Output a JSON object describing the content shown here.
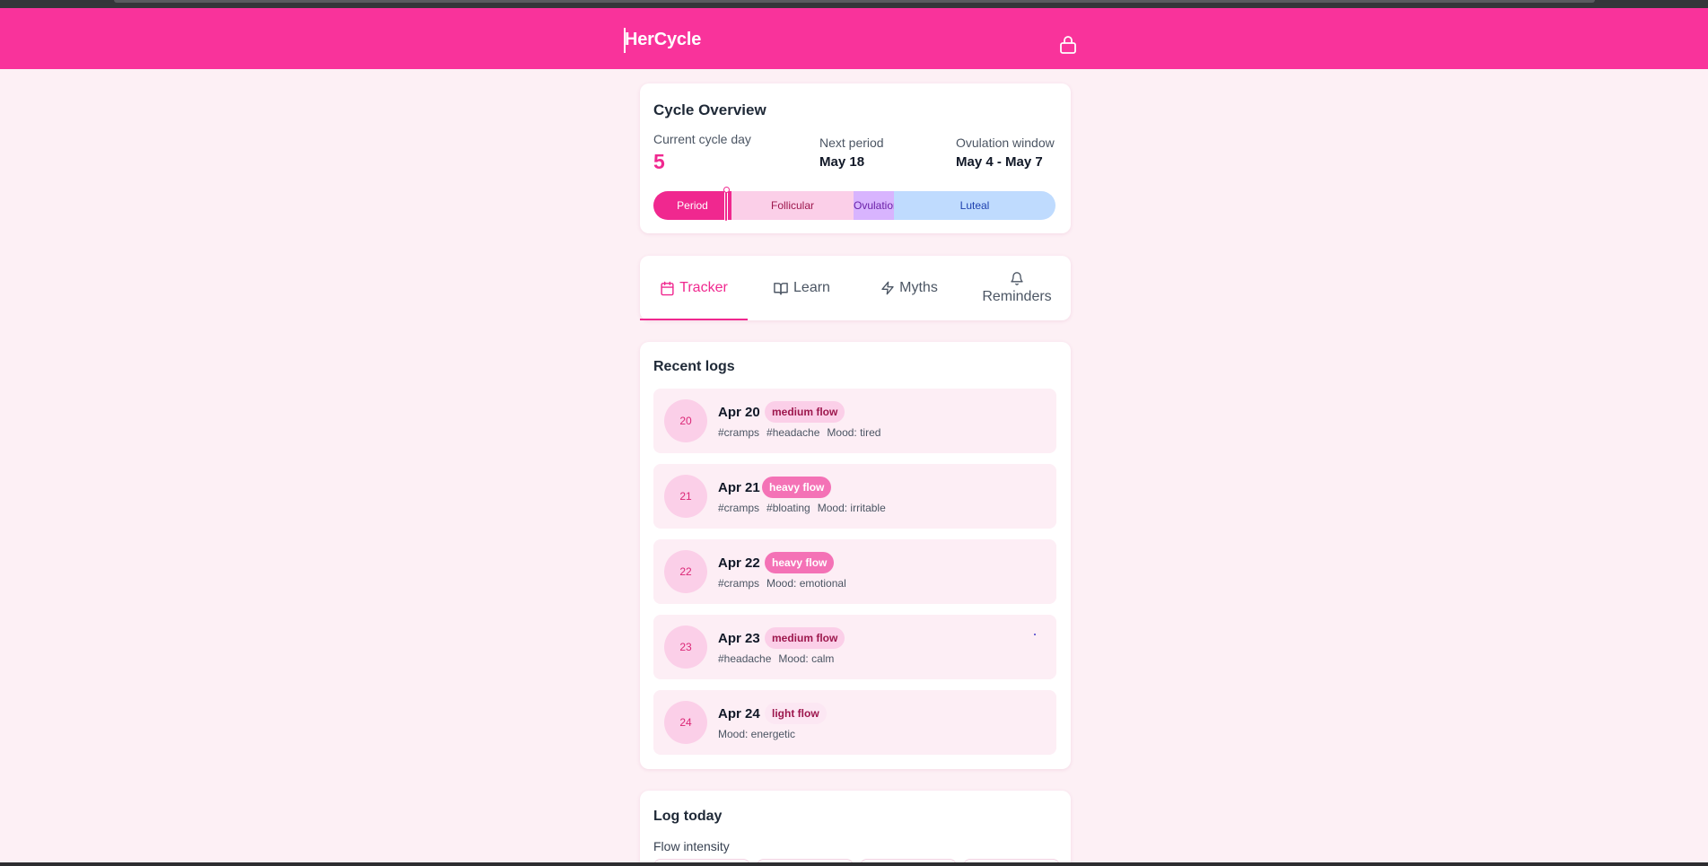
{
  "app": {
    "title": "HerCycle",
    "lock_icon": "lock-icon",
    "accent_color": "#f9339b"
  },
  "overview": {
    "title": "Cycle Overview",
    "current_day_label": "Current cycle day",
    "current_day_value": "5",
    "next_period_label": "Next period",
    "next_period_value": "May 18",
    "ovulation_label": "Ovulation window",
    "ovulation_value": "May 4 - May 7",
    "phases": [
      {
        "label": "Period",
        "color": "#f0288f"
      },
      {
        "label": "Follicular",
        "color": "#fbcfe8"
      },
      {
        "label": "Ovulation",
        "color": "#d8b4fe"
      },
      {
        "label": "Luteal",
        "color": "#bfdbfe"
      }
    ]
  },
  "tabs": [
    {
      "label": "Tracker",
      "icon": "calendar-icon",
      "active": true
    },
    {
      "label": "Learn",
      "icon": "book-icon",
      "active": false
    },
    {
      "label": "Myths",
      "icon": "lightning-icon",
      "active": false
    },
    {
      "label": "Reminders",
      "icon": "bell-icon",
      "active": false
    }
  ],
  "recent_logs": {
    "title": "Recent logs",
    "items": [
      {
        "day": "20",
        "date": "Apr 20",
        "flow": "medium flow",
        "tags": [
          "#cramps",
          "#headache"
        ],
        "mood": "Mood: tired"
      },
      {
        "day": "21",
        "date": "Apr 21",
        "flow": "heavy flow",
        "tags": [
          "#cramps",
          "#bloating"
        ],
        "mood": "Mood: irritable"
      },
      {
        "day": "22",
        "date": "Apr 22",
        "flow": "heavy flow",
        "tags": [
          "#cramps"
        ],
        "mood": "Mood: emotional"
      },
      {
        "day": "23",
        "date": "Apr 23",
        "flow": "medium flow",
        "tags": [
          "#headache"
        ],
        "mood": "Mood: calm"
      },
      {
        "day": "24",
        "date": "Apr 24",
        "flow": "light flow",
        "tags": [],
        "mood": "Mood: energetic"
      }
    ]
  },
  "log_today": {
    "title": "Log today",
    "flow_label": "Flow intensity"
  }
}
